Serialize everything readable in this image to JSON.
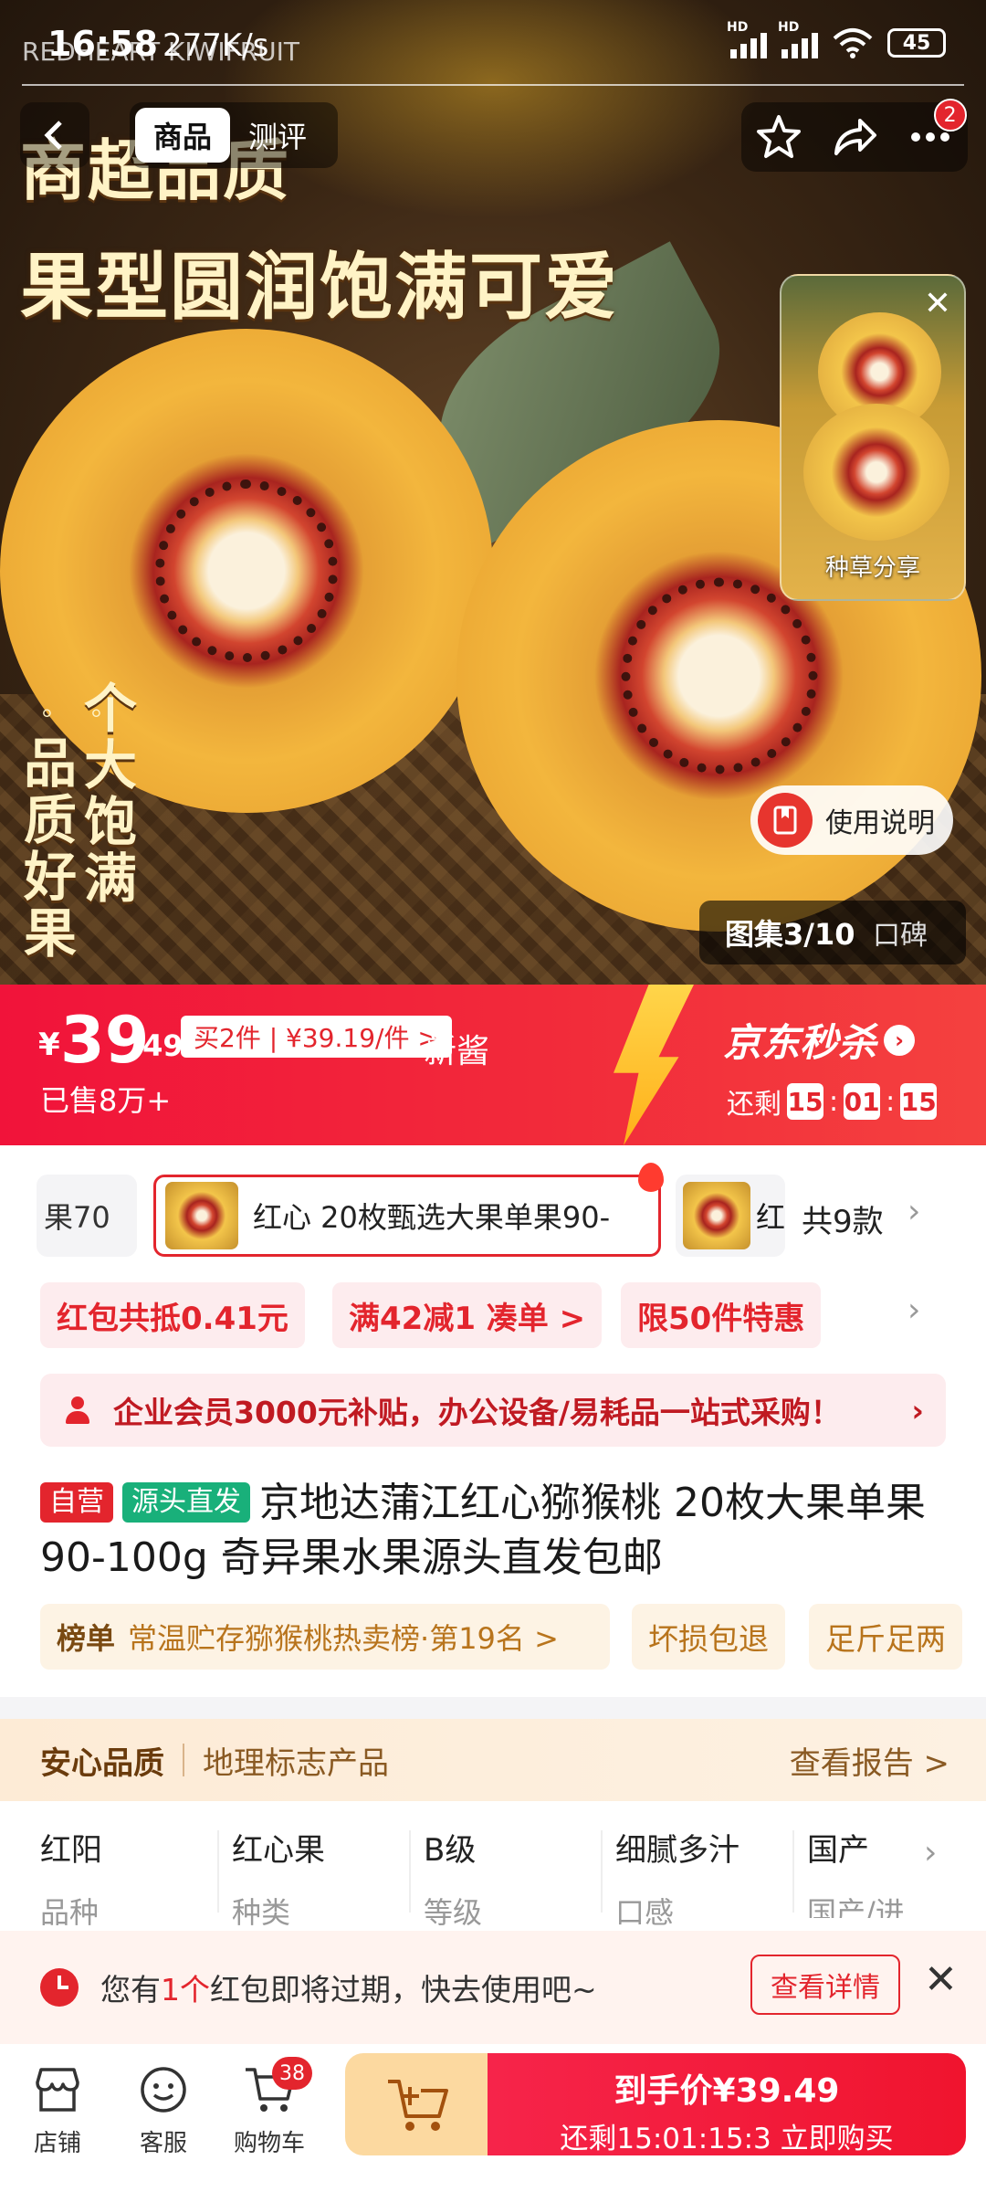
{
  "status_bar": {
    "time": "16:58",
    "speed": "277K/s",
    "overlay_text": "REDHEART KIWIFRUIT",
    "battery": "45",
    "net1": "HD",
    "net2": "HD"
  },
  "nav": {
    "tabs": [
      "商品",
      "测评"
    ],
    "active_tab": "商品",
    "notification_count": "2",
    "icons": [
      "back-icon",
      "star-icon",
      "share-icon",
      "more-icon"
    ]
  },
  "hero": {
    "headline_1": "商超品质",
    "headline_2": "果型圆润饱满可爱",
    "vertical_col_1": "个大饱满",
    "vertical_col_2": "品质好果",
    "dots": "。。",
    "share_label": "种草分享",
    "usage_label": "使用说明",
    "gallery_label": "图集3/10",
    "reviews_label": "口碑"
  },
  "price": {
    "currency": "¥",
    "integer": "39",
    "cents": ".49",
    "buy_two": "买2件 | ¥39.19/件 >",
    "overlay": "新酱",
    "sold": "已售8万+",
    "flash_brand": "京东秒杀",
    "remain_label": "还剩",
    "countdown": [
      "15",
      "01",
      "15"
    ],
    "countdown_sep": ":"
  },
  "variants": {
    "items": [
      "果70",
      "红心 20枚甄选大果单果90-",
      "红"
    ],
    "selected_index": 1,
    "total": "共9款"
  },
  "promos": [
    "红包共抵0.41元",
    "满42减1  凑单 >",
    "限50件特惠"
  ],
  "enterprise": "企业会员3000元补贴，办公设备/易耗品一站式采购！",
  "product": {
    "tag_self": "自营",
    "tag_source": "源头直发",
    "title": "京地达蒲江红心猕猴桃 20枚大果单果90-100g 奇异果水果源头直发包邮"
  },
  "rank": {
    "label": "榜单",
    "text": "常温贮存猕猴桃热卖榜·第19名 >"
  },
  "service_tags": [
    "坏损包退",
    "足斤足两"
  ],
  "quality": {
    "title": "安心品质",
    "subtitle": "地理标志产品",
    "report": "查看报告 >"
  },
  "attributes": [
    {
      "value": "红阳",
      "key": "品种"
    },
    {
      "value": "红心果",
      "key": "种类"
    },
    {
      "value": "B级",
      "key": "等级"
    },
    {
      "value": "细腻多汁",
      "key": "口感"
    },
    {
      "value": "国产",
      "key": "国产/进"
    }
  ],
  "notice": {
    "prefix": "您有",
    "count": "1个",
    "suffix": "红包即将过期，快去使用吧~",
    "detail": "查看详情"
  },
  "bottom_bar": {
    "store": "店铺",
    "service": "客服",
    "cart": "购物车",
    "cart_count": "38",
    "final_price_label": "到手价¥39.49",
    "buy_now": "还剩15:01:15:3  立即购买"
  },
  "colors": {
    "brand_red": "#e3252d",
    "price_banner": "#f1133a",
    "gold": "#ffd54a",
    "quality_bg": "#fdebd6"
  }
}
